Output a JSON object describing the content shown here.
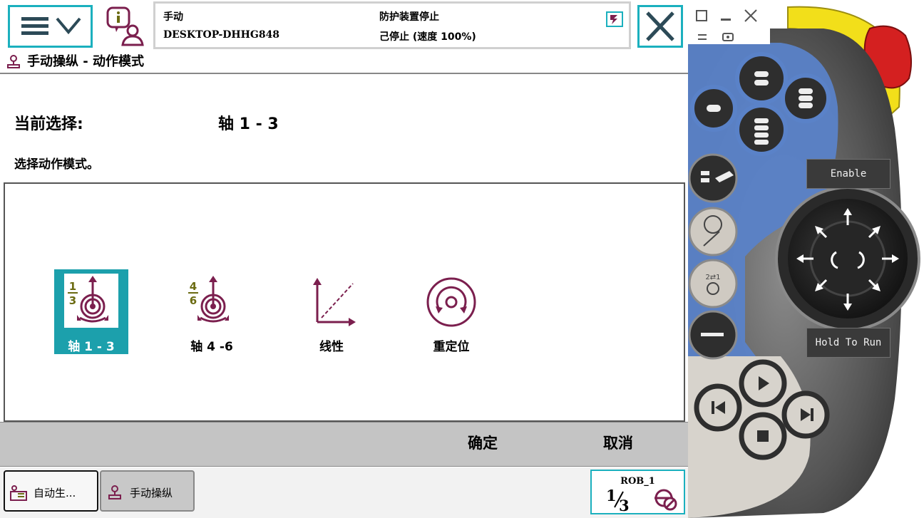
{
  "header": {
    "mode": "手动",
    "system_name": "DESKTOP-DHHG848",
    "safety_status": "防护装置停止",
    "run_status": "己停止 (速度 100%)"
  },
  "window": {
    "title": "手动操纵 - 动作模式"
  },
  "selection": {
    "label": "当前选择:",
    "value": "轴 1 - 3",
    "prompt": "选择动作模式。"
  },
  "modes": [
    {
      "label": "轴 1 - 3",
      "icon": "axis-1-3-icon",
      "selected": true
    },
    {
      "label": "轴 4 -6",
      "icon": "axis-4-6-icon",
      "selected": false
    },
    {
      "label": "线性",
      "icon": "linear-icon",
      "selected": false
    },
    {
      "label": "重定位",
      "icon": "reorient-icon",
      "selected": false
    }
  ],
  "actions": {
    "ok": "确定",
    "cancel": "取消"
  },
  "taskbar": {
    "items": [
      {
        "label": "自动生...",
        "icon": "production-window-icon"
      },
      {
        "label": "手动操纵",
        "icon": "jogging-icon"
      }
    ],
    "rob": {
      "name": "ROB_1",
      "fraction_num": "1",
      "fraction_den": "3"
    }
  },
  "pendant": {
    "enable_label": "Enable",
    "hold_to_run_label": "Hold To Run"
  },
  "colors": {
    "accent": "#1bb0be",
    "selected": "#1ca0ac",
    "icon_primary": "#7b1f4e",
    "icon_fraction": "#6b6b12",
    "pendant_blue": "#5a82c8",
    "stop_red": "#d42020",
    "enable_yellow": "#f2df1a"
  }
}
